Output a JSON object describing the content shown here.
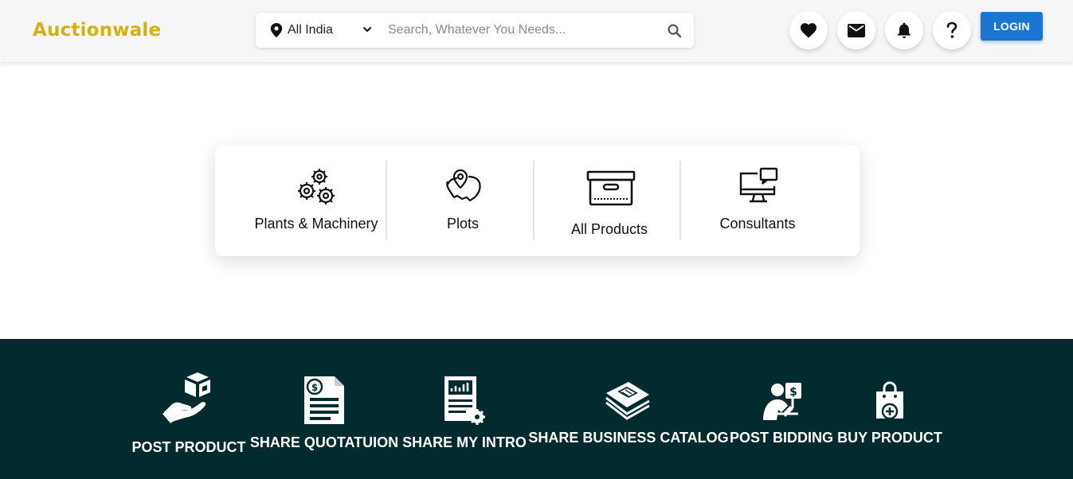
{
  "header": {
    "logo": "Auctionwale",
    "location": "All India",
    "search_placeholder": "Search, Whatever You Needs...",
    "login_label": "LOGIN",
    "icons": [
      "heart-icon",
      "mail-icon",
      "bell-icon",
      "help-icon"
    ]
  },
  "categories": [
    {
      "label": "Plants & Machinery",
      "icon": "gears-icon"
    },
    {
      "label": "Plots",
      "icon": "map-pin-icon"
    },
    {
      "label": "All Products",
      "icon": "archive-box-icon"
    },
    {
      "label": "Consultants",
      "icon": "computer-chat-icon"
    }
  ],
  "actions": [
    {
      "label": "POST PRODUCT",
      "icon": "hand-box-icon"
    },
    {
      "label": "SHARE QUOTATUION",
      "icon": "quotation-icon"
    },
    {
      "label": "SHARE MY INTRO",
      "icon": "intro-document-icon"
    },
    {
      "label": "SHARE BUSINESS CATALOG",
      "icon": "catalog-icon"
    },
    {
      "label": "POST BIDDING",
      "icon": "bidding-icon"
    },
    {
      "label": "BUY PRODUCT",
      "icon": "shopping-bag-icon"
    }
  ],
  "colors": {
    "brand": "#d4b10e",
    "accent": "#1976d2",
    "footer_bg": "#022b2f"
  }
}
